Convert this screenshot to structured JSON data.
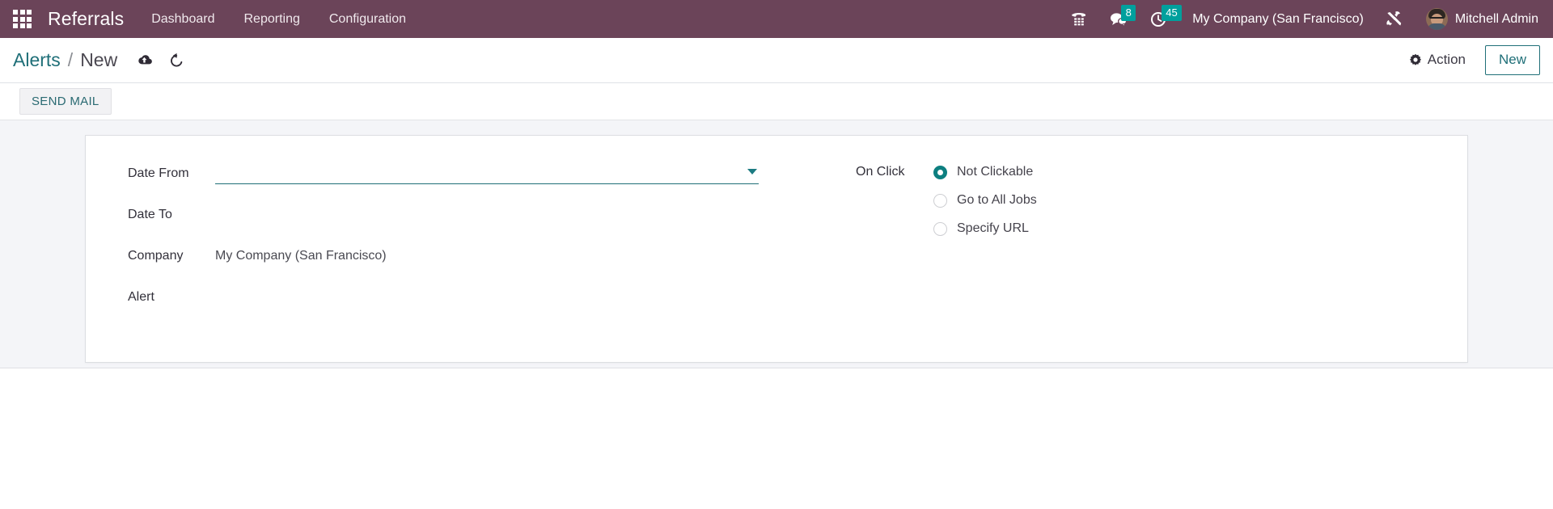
{
  "navbar": {
    "apps_icon": "apps-grid-icon",
    "brand": "Referrals",
    "menu": [
      {
        "label": "Dashboard"
      },
      {
        "label": "Reporting"
      },
      {
        "label": "Configuration"
      }
    ],
    "systray": {
      "voip_icon": "phone-dialpad-icon",
      "messages_icon": "chat-bubble-icon",
      "messages_count": "8",
      "activities_icon": "clock-icon",
      "activities_count": "45",
      "company": "My Company (San Francisco)",
      "debug_icon": "tools-icon",
      "avatar_icon": "user-avatar",
      "user_name": "Mitchell Admin"
    },
    "colors": {
      "background": "#6B4459",
      "badge": "#00A09D",
      "text": "#ffffff"
    }
  },
  "control_panel": {
    "breadcrumb": {
      "parent": "Alerts",
      "separator": "/",
      "current": "New"
    },
    "save_icon": "cloud-upload-icon",
    "discard_icon": "undo-arrow-icon",
    "action_icon": "gear-icon",
    "action_label": "Action",
    "new_button_label": "New",
    "colors": {
      "link": "#1f6f78",
      "current": "#4b4851"
    }
  },
  "statusbar": {
    "send_mail_label": "SEND MAIL"
  },
  "form": {
    "fields": [
      {
        "name": "date_from",
        "label": "Date From",
        "value": "",
        "placeholder": "",
        "widget": "date",
        "focused": true,
        "dropdown_icon": "caret-down-icon"
      },
      {
        "name": "date_to",
        "label": "Date To",
        "value": "",
        "placeholder": "",
        "widget": "date"
      },
      {
        "name": "company",
        "label": "Company",
        "value": "My Company (San Francisco)",
        "widget": "many2one"
      },
      {
        "name": "alert",
        "label": "Alert",
        "value": "",
        "widget": "char"
      }
    ],
    "on_click": {
      "label": "On Click",
      "selected": "Not Clickable",
      "options": [
        {
          "label": "Not Clickable",
          "checked": true
        },
        {
          "label": "Go to All Jobs",
          "checked": false
        },
        {
          "label": "Specify URL",
          "checked": false
        }
      ]
    },
    "colors": {
      "accent": "#0d7f80",
      "sheet_bg": "#ffffff",
      "page_bg": "#f4f5f8"
    }
  }
}
